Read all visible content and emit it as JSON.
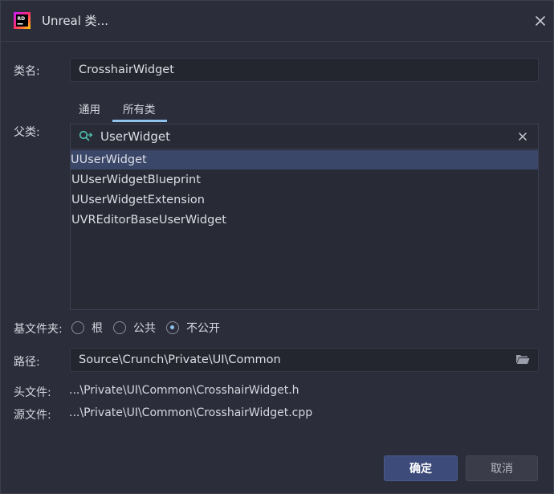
{
  "window": {
    "title": "Unreal 类...",
    "app_icon": "rider-rd-logo",
    "close_icon": "close-icon"
  },
  "class_name": {
    "label": "类名:",
    "value": "CrosshairWidget"
  },
  "tabs": [
    {
      "label": "通用",
      "active": false
    },
    {
      "label": "所有类",
      "active": true
    }
  ],
  "parent_class": {
    "label": "父类:",
    "search_value": "UserWidget",
    "search_icon": "search-icon",
    "clear_icon": "clear-icon",
    "results": [
      {
        "label": "UUserWidget",
        "selected": true
      },
      {
        "label": "UUserWidgetBlueprint",
        "selected": false
      },
      {
        "label": "UUserWidgetExtension",
        "selected": false
      },
      {
        "label": "UVREditorBaseUserWidget",
        "selected": false
      }
    ]
  },
  "base_folder": {
    "label": "基文件夹:",
    "options": [
      {
        "label": "根",
        "checked": false
      },
      {
        "label": "公共",
        "checked": false
      },
      {
        "label": "不公开",
        "checked": true
      }
    ]
  },
  "path": {
    "label": "路径:",
    "value": "Source\\Crunch\\Private\\UI\\Common",
    "browse_icon": "folder-icon"
  },
  "header_file": {
    "label": "头文件:",
    "value": "...\\Private\\UI\\Common\\CrosshairWidget.h"
  },
  "source_file": {
    "label": "源文件:",
    "value": "...\\Private\\UI\\Common\\CrosshairWidget.cpp"
  },
  "buttons": {
    "ok": "确定",
    "cancel": "取消"
  },
  "colors": {
    "background": "#2b2d3a",
    "accent": "#8ec2ea",
    "selection": "#3a4768",
    "primary_button": "#3d4b7a"
  }
}
